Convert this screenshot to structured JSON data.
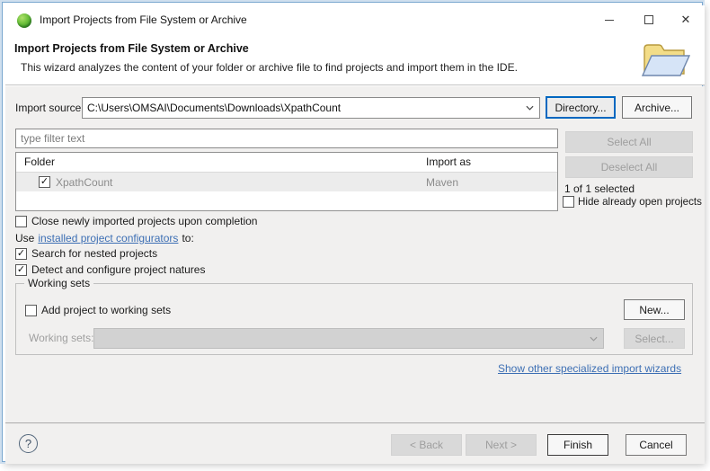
{
  "window": {
    "title": "Import Projects from File System or Archive"
  },
  "header": {
    "title": "Import Projects from File System or Archive",
    "description": "This wizard analyzes the content of your folder or archive file to find projects and import them in the IDE."
  },
  "import_source": {
    "label": "Import source:",
    "value": "C:\\Users\\OMSAI\\Documents\\Downloads\\XpathCount",
    "directory_button": "Directory...",
    "archive_button": "Archive..."
  },
  "filter": {
    "placeholder": "type filter text"
  },
  "table": {
    "columns": [
      "Folder",
      "Import as"
    ],
    "rows": [
      {
        "checked": true,
        "folder": "XpathCount",
        "import_as": "Maven"
      }
    ]
  },
  "side_panel": {
    "select_all": "Select All",
    "deselect_all": "Deselect All",
    "selection_status": "1 of 1 selected",
    "hide_open_label": "Hide already open projects"
  },
  "options": {
    "close_imported_label": "Close newly imported projects upon completion",
    "use_prefix": "Use",
    "configurators_link": "installed project configurators",
    "use_suffix": "to:",
    "nested_label": "Search for nested projects",
    "natures_label": "Detect and configure project natures"
  },
  "working_sets": {
    "legend": "Working sets",
    "add_label": "Add project to working sets",
    "new_button": "New...",
    "field_label": "Working sets:",
    "select_button": "Select..."
  },
  "footer": {
    "wizards_link": "Show other specialized import wizards",
    "back_button": "< Back",
    "next_button": "Next >",
    "finish_button": "Finish",
    "cancel_button": "Cancel"
  },
  "icons": {
    "close": "✕",
    "help": "?",
    "check": "✓"
  },
  "colors": {
    "accent_focus": "#0067c0",
    "link": "#3d6fb4",
    "body_bg": "#f1f0ef",
    "selected_row": "#ececec"
  }
}
